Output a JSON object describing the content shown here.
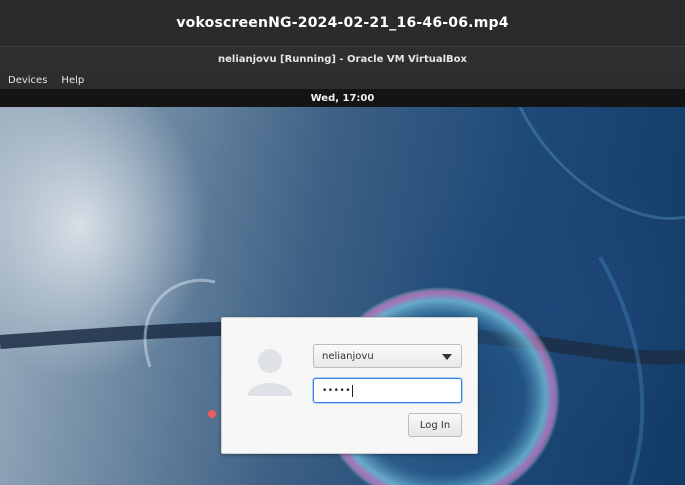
{
  "player": {
    "title": "vokoscreenNG-2024-02-21_16-46-06.mp4"
  },
  "vm_window": {
    "title": "nelianjovu [Running] - Oracle VM VirtualBox"
  },
  "menubar": {
    "items": [
      {
        "label": "Devices"
      },
      {
        "label": "Help"
      }
    ]
  },
  "topbar": {
    "clock": "Wed, 17:00"
  },
  "login": {
    "avatar_icon": "user-avatar-icon",
    "username": "nelianjovu",
    "password_masked": "•••••",
    "login_button": "Log In",
    "accent_color": "#3584e4"
  }
}
